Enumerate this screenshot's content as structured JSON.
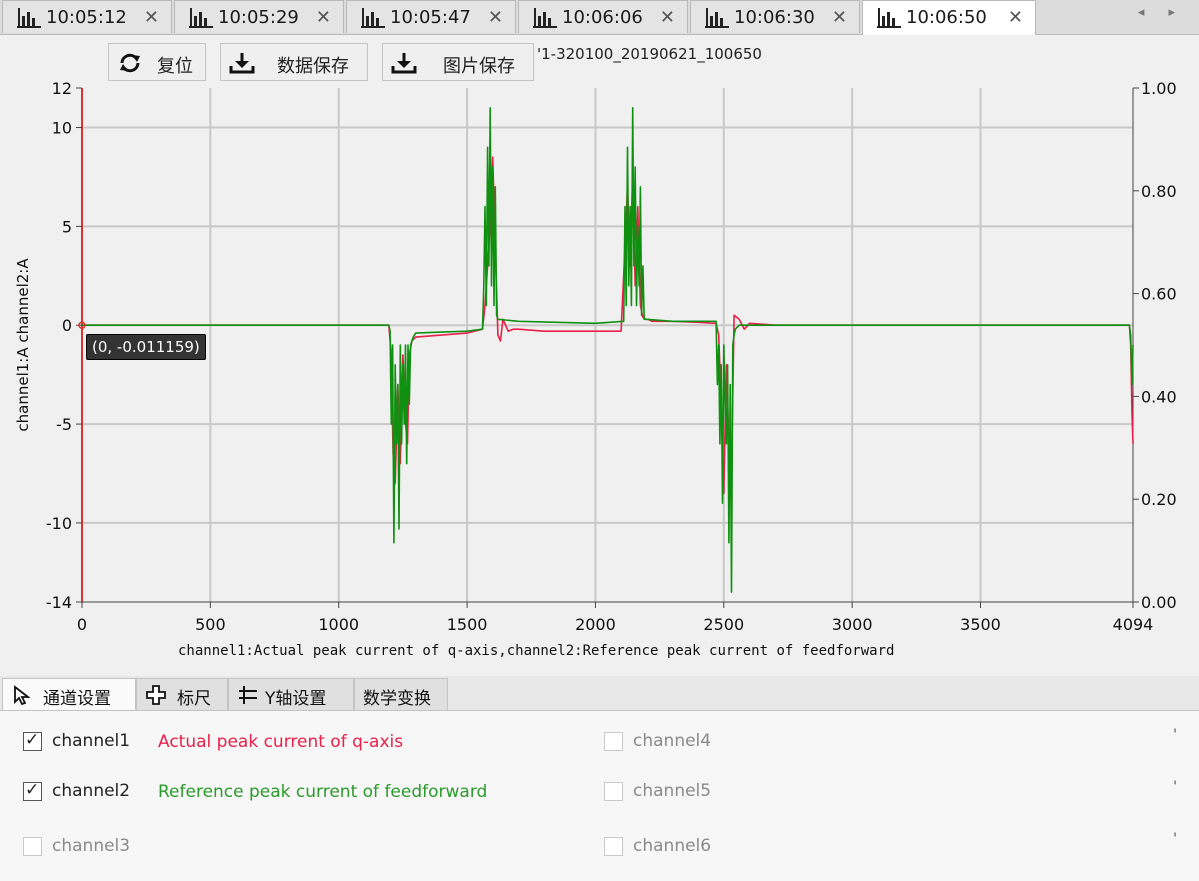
{
  "tabs": [
    {
      "label": "10:05:12",
      "icon": "bar-chart-icon",
      "active": false
    },
    {
      "label": "10:05:29",
      "icon": "bar-chart-icon",
      "active": false
    },
    {
      "label": "10:05:47",
      "icon": "bar-chart-icon",
      "active": false
    },
    {
      "label": "10:06:06",
      "icon": "bar-chart-icon",
      "active": false
    },
    {
      "label": "10:06:30",
      "icon": "bar-chart-icon",
      "active": false
    },
    {
      "label": "10:06:50",
      "icon": "bar-chart-icon",
      "active": true
    }
  ],
  "tab_close_glyph": "✕",
  "tab_scroll_glyphs": "◂ ▸",
  "toolbar": {
    "reset_label": "复位",
    "save_data_label": "数据保存",
    "save_image_label": "图片保存"
  },
  "file_title": "'1-320100_20190621_100650",
  "chart_data": {
    "type": "line",
    "x_caption": "channel1:Actual peak current of q-axis,channel2:Reference peak current of feedforward",
    "ylabel": "channel1:A channel2:A",
    "xlim": [
      0,
      4094
    ],
    "ylim": [
      -14,
      12
    ],
    "y2lim": [
      0.0,
      1.0
    ],
    "x_ticks": [
      "0",
      "500",
      "1000",
      "1500",
      "2000",
      "2500",
      "3000",
      "3500",
      "4094"
    ],
    "y_ticks": [
      "12",
      "10",
      "5",
      "0",
      "-5",
      "-10",
      "-14"
    ],
    "y2_ticks": [
      "1.00",
      "0.80",
      "0.60",
      "0.40",
      "0.20",
      "0.00"
    ],
    "grid": true,
    "cursor_readout": "(0, -0.011159)",
    "colors": {
      "channel1": "#e8204a",
      "channel2": "#109010",
      "grid": "#c8c8c8",
      "axis": "#e03030"
    },
    "series": [
      {
        "name": "channel1",
        "color": "#e8204a",
        "x": [
          0,
          1195,
          1205,
          1212,
          1220,
          1230,
          1240,
          1250,
          1260,
          1268,
          1275,
          1285,
          1300,
          1400,
          1500,
          1560,
          1570,
          1580,
          1590,
          1600,
          1610,
          1620,
          1630,
          1640,
          1660,
          1680,
          1700,
          1800,
          2000,
          2100,
          2115,
          2125,
          2135,
          2145,
          2155,
          2165,
          2175,
          2185,
          2195,
          2205,
          2220,
          2300,
          2400,
          2470,
          2480,
          2490,
          2500,
          2510,
          2520,
          2530,
          2540,
          2560,
          2580,
          2600,
          2700,
          3000,
          3500,
          4080,
          4085,
          4090,
          4094
        ],
        "y": [
          0,
          0,
          -1.5,
          -6.5,
          -8,
          -3,
          -7,
          -1.5,
          -5,
          -6,
          -1.5,
          -0.8,
          -0.6,
          -0.5,
          -0.4,
          -0.2,
          1,
          3,
          5,
          8.5,
          4,
          -0.5,
          -0.8,
          0.3,
          -0.3,
          -0.2,
          -0.2,
          -0.3,
          -0.3,
          -0.3,
          4,
          7,
          3,
          7.5,
          2,
          6,
          1,
          0.4,
          0.3,
          0.3,
          0.2,
          0.2,
          0.15,
          0.1,
          -0.5,
          -4,
          -8.5,
          -2,
          -6,
          -7.5,
          0.5,
          0.3,
          -0.2,
          0.1,
          0,
          0,
          0,
          0,
          -1,
          -4.5,
          -6
        ]
      },
      {
        "name": "channel2",
        "color": "#109010",
        "x": [
          0,
          1195,
          1200,
          1205,
          1210,
          1215,
          1220,
          1225,
          1230,
          1235,
          1240,
          1245,
          1250,
          1255,
          1260,
          1265,
          1270,
          1275,
          1280,
          1290,
          1300,
          1400,
          1500,
          1560,
          1565,
          1570,
          1575,
          1580,
          1585,
          1590,
          1595,
          1600,
          1605,
          1610,
          1615,
          1620,
          1700,
          2000,
          2110,
          2115,
          2120,
          2125,
          2130,
          2135,
          2140,
          2145,
          2150,
          2155,
          2160,
          2165,
          2170,
          2175,
          2180,
          2185,
          2190,
          2200,
          2300,
          2470,
          2475,
          2480,
          2485,
          2490,
          2495,
          2500,
          2505,
          2510,
          2515,
          2520,
          2525,
          2530,
          2535,
          2540,
          2545,
          2560,
          3000,
          4080,
          4085,
          4090,
          4094
        ],
        "y": [
          0,
          0,
          -0.3,
          -5,
          -1,
          -11,
          -2,
          -6,
          -3,
          -10.3,
          -1,
          -6,
          -2,
          -5,
          -1,
          -7,
          -1,
          -4,
          -1,
          -0.6,
          -0.4,
          -0.35,
          -0.3,
          -0.2,
          2,
          6,
          1,
          9,
          3,
          11,
          2,
          8,
          1,
          7,
          0.5,
          0.3,
          0.2,
          0.1,
          0.2,
          6,
          1,
          9,
          2,
          6,
          1,
          11,
          3,
          8,
          1,
          5,
          2,
          7,
          0.5,
          3,
          0.3,
          0.3,
          0.2,
          0.2,
          -3,
          -1,
          -6,
          -2,
          -9,
          -1,
          -4,
          -6,
          -2,
          -11,
          -3,
          -13.5,
          -1,
          -0.5,
          -0.2,
          0,
          0,
          0,
          -0.5,
          -3,
          -1
        ]
      }
    ]
  },
  "bottom_tabs": [
    {
      "label": "通道设置",
      "icon": "cursor-icon",
      "active": true
    },
    {
      "label": "标尺",
      "icon": "crosshair-icon",
      "active": false
    },
    {
      "label": "Y轴设置",
      "icon": "y-axis-icon",
      "active": false
    },
    {
      "label": "数学变换",
      "icon": "",
      "active": false
    }
  ],
  "channels": [
    {
      "label": "channel1",
      "checked": true,
      "enabled": true,
      "desc": "Actual peak current of q-axis",
      "desc_color": "#e8204a"
    },
    {
      "label": "channel2",
      "checked": true,
      "enabled": true,
      "desc": "Reference peak current of feedforward",
      "desc_color": "#2a9a2a"
    },
    {
      "label": "channel3",
      "checked": false,
      "enabled": false,
      "desc": "",
      "desc_color": ""
    },
    {
      "label": "channel4",
      "checked": false,
      "enabled": false,
      "desc": "",
      "desc_color": ""
    },
    {
      "label": "channel5",
      "checked": false,
      "enabled": false,
      "desc": "",
      "desc_color": ""
    },
    {
      "label": "channel6",
      "checked": false,
      "enabled": false,
      "desc": "",
      "desc_color": ""
    }
  ],
  "checkmark_glyph": "✓",
  "panel_tick_glyph": "'"
}
